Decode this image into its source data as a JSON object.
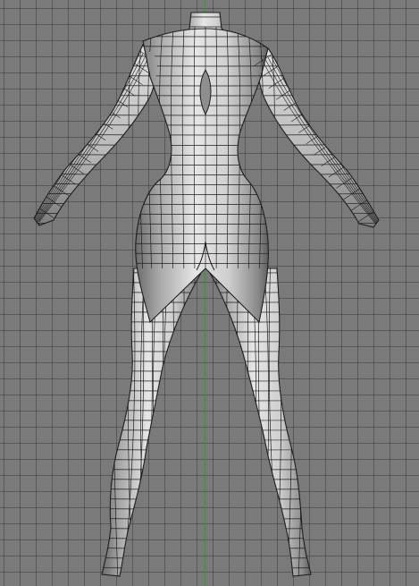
{
  "viewport": {
    "view": "back-orthographic",
    "shading": "smooth-shaded-with-wireframe",
    "background_color": "#7a7a7a",
    "grid_color": "#4a4a4a",
    "axis_color": "#2d9c3a",
    "model_base_color": "#c9c9c9",
    "wire_color": "#1e1e1e"
  },
  "model": {
    "subject": "female-body-base-mesh",
    "parts": [
      "neck",
      "torso",
      "left-arm",
      "right-arm",
      "left-leg",
      "right-leg"
    ]
  }
}
